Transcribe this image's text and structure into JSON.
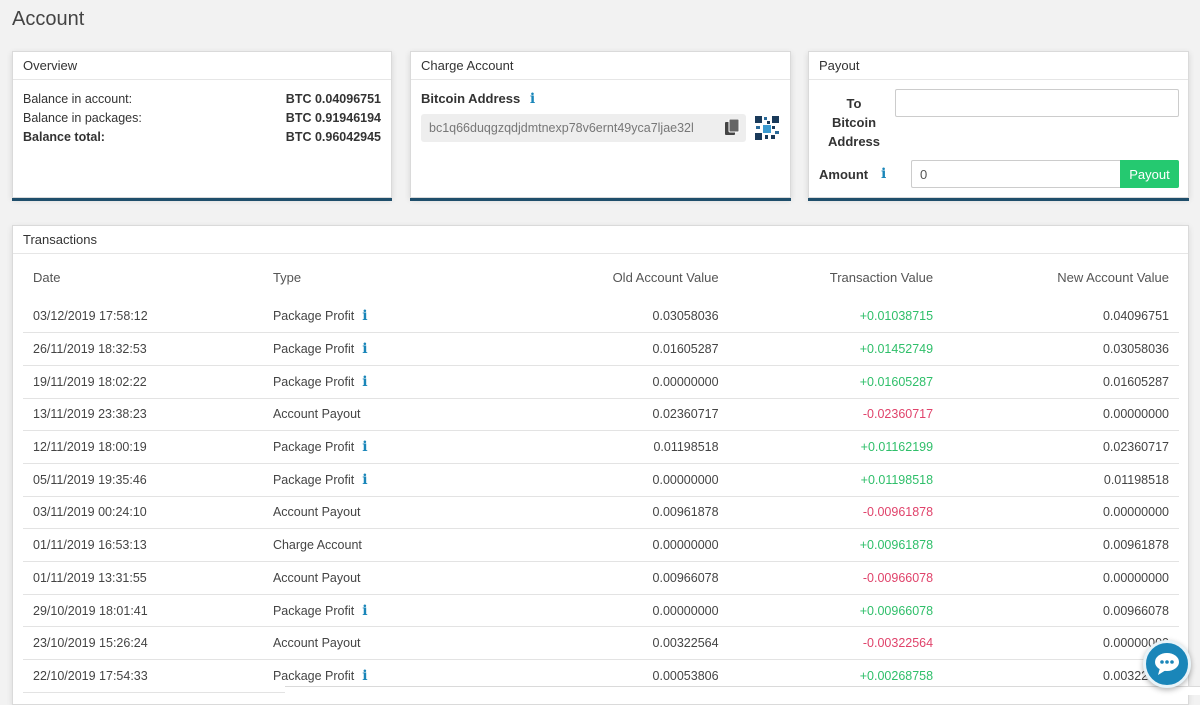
{
  "page": {
    "title": "Account"
  },
  "overview": {
    "title": "Overview",
    "rows": [
      {
        "label": "Balance in account:",
        "value": "BTC 0.04096751"
      },
      {
        "label": "Balance in packages:",
        "value": "BTC 0.91946194"
      },
      {
        "label": "Balance total:",
        "value": "BTC 0.96042945"
      }
    ]
  },
  "charge": {
    "title": "Charge Account",
    "address_label": "Bitcoin Address",
    "address": "bc1q66duqgzqdjdmtnexp78v6ernt49yca7ljae32l",
    "icons": {
      "info": "info-icon",
      "copy": "copy-icon",
      "qr": "qr-code-icon"
    }
  },
  "payout": {
    "title": "Payout",
    "to_label_line1": "To",
    "to_label_line2": "Bitcoin",
    "to_label_line3": "Address",
    "to_value": "",
    "amount_label": "Amount",
    "amount_value": "0",
    "button_label": "Payout"
  },
  "transactions": {
    "title": "Transactions",
    "headers": {
      "date": "Date",
      "type": "Type",
      "old": "Old Account Value",
      "tx": "Transaction Value",
      "new": "New Account Value"
    },
    "rows": [
      {
        "date": "03/12/2019 17:58:12",
        "type": "Package Profit",
        "info": "i",
        "old": "0.03058036",
        "tx": "+0.01038715",
        "new": "0.04096751"
      },
      {
        "date": "26/11/2019 18:32:53",
        "type": "Package Profit",
        "info": "i",
        "old": "0.01605287",
        "tx": "+0.01452749",
        "new": "0.03058036"
      },
      {
        "date": "19/11/2019 18:02:22",
        "type": "Package Profit",
        "info": "i",
        "old": "0.00000000",
        "tx": "+0.01605287",
        "new": "0.01605287"
      },
      {
        "date": "13/11/2019 23:38:23",
        "type": "Account Payout",
        "info": "",
        "old": "0.02360717",
        "tx": "-0.02360717",
        "new": "0.00000000"
      },
      {
        "date": "12/11/2019 18:00:19",
        "type": "Package Profit",
        "info": "i",
        "old": "0.01198518",
        "tx": "+0.01162199",
        "new": "0.02360717"
      },
      {
        "date": "05/11/2019 19:35:46",
        "type": "Package Profit",
        "info": "i",
        "old": "0.00000000",
        "tx": "+0.01198518",
        "new": "0.01198518"
      },
      {
        "date": "03/11/2019 00:24:10",
        "type": "Account Payout",
        "info": "",
        "old": "0.00961878",
        "tx": "-0.00961878",
        "new": "0.00000000"
      },
      {
        "date": "01/11/2019 16:53:13",
        "type": "Charge Account",
        "info": "",
        "old": "0.00000000",
        "tx": "+0.00961878",
        "new": "0.00961878"
      },
      {
        "date": "01/11/2019 13:31:55",
        "type": "Account Payout",
        "info": "",
        "old": "0.00966078",
        "tx": "-0.00966078",
        "new": "0.00000000"
      },
      {
        "date": "29/10/2019 18:01:41",
        "type": "Package Profit",
        "info": "i",
        "old": "0.00000000",
        "tx": "+0.00966078",
        "new": "0.00966078"
      },
      {
        "date": "23/10/2019 15:26:24",
        "type": "Account Payout",
        "info": "",
        "old": "0.00322564",
        "tx": "-0.00322564",
        "new": "0.00000000"
      },
      {
        "date": "22/10/2019 17:54:33",
        "type": "Package Profit",
        "info": "i",
        "old": "0.00053806",
        "tx": "+0.00268758",
        "new": "0.00322564"
      }
    ]
  },
  "colors": {
    "accent": "#1a86b9",
    "positive": "#2fbf6a",
    "negative": "#e0436b",
    "button": "#25c970",
    "card_shadow": "#1f4e6b"
  },
  "chat": {
    "icon": "chat-bubble-icon"
  }
}
